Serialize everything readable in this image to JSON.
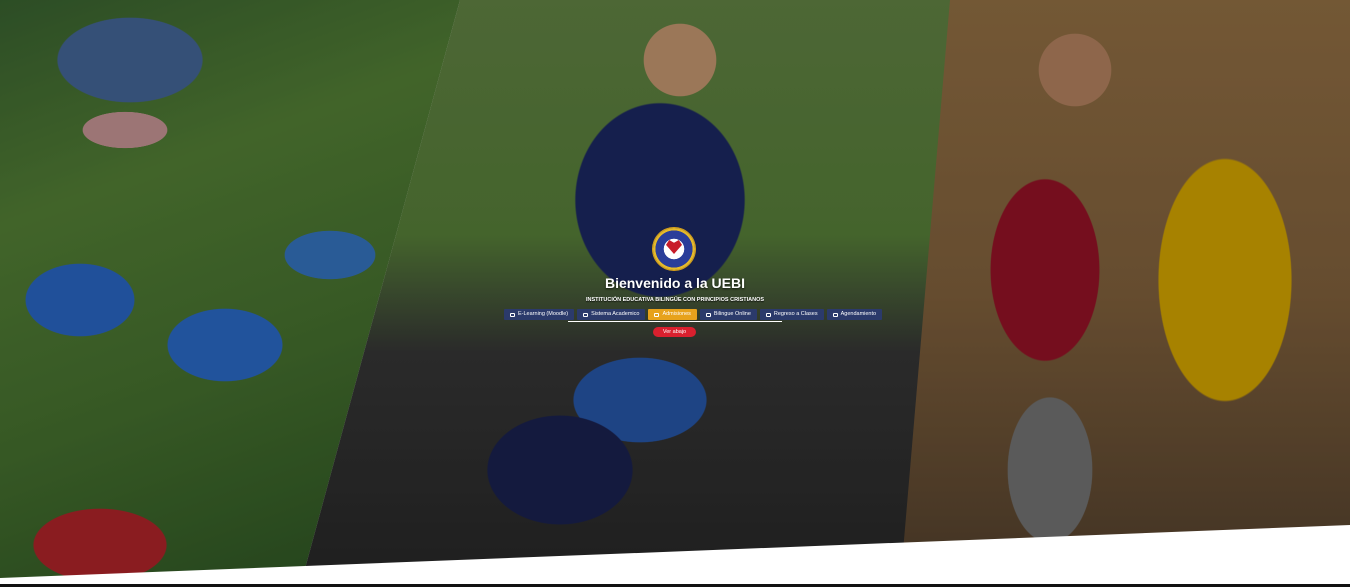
{
  "hero": {
    "title": "Bienvenido a la UEBI",
    "subtitle": "INSTITUCIÓN EDUCATIVA BILINGÜE CON PRINCIPIOS CRISTIANOS",
    "logo_icon": "school-crest-icon",
    "cta_label": "Ver abajo",
    "cta_color": "#d9202e"
  },
  "nav": {
    "items": [
      {
        "label": "E-Learning (Moodle)",
        "icon": "moodle-icon",
        "active": false
      },
      {
        "label": "Sistema Academico",
        "icon": "document-icon",
        "active": false
      },
      {
        "label": "Admisiones",
        "icon": "mail-icon",
        "active": true
      },
      {
        "label": "Bilingue Online",
        "icon": "monitor-icon",
        "active": false
      },
      {
        "label": "Regreso a Clases",
        "icon": "monitor-icon",
        "active": false
      },
      {
        "label": "Agendamiento",
        "icon": "calendar-icon",
        "active": false
      }
    ],
    "active_color": "#e7a21c",
    "item_color": "#2b3a6b"
  }
}
